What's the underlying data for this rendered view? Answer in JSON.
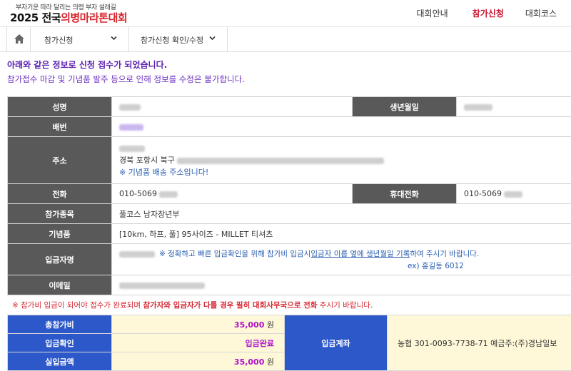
{
  "header": {
    "tagline": "부자기운 따라 달리는 의령 부자 설레길",
    "logo_prefix": "2025 전국",
    "logo_accent": "의병마라톤대회",
    "nav": [
      "대회안내",
      "참가신청",
      "대회코스"
    ],
    "active_nav": "참가신청",
    "accent_color": "#c8102e"
  },
  "subnav": {
    "home_icon": "home-icon",
    "menu1": "참가신청",
    "menu2": "참가신청 확인/수정"
  },
  "messages": {
    "line1": "아래와 같은 정보로 신청 접수가 되었습니다.",
    "line2": "참가접수 마감 및 기념품 발주 등으로 인해 정보를 수정은 불가합니다."
  },
  "info": {
    "name_label": "성명",
    "birth_label": "생년월일",
    "bib_label": "배번",
    "address_label": "주소",
    "address_city": "경북 포항시 북구",
    "address_note": "※ 기념품 배송 주소입니다!",
    "phone_label": "전화",
    "phone_value": "010-5069",
    "mobile_label": "휴대전화",
    "mobile_value": "010-5069",
    "event_label": "참가종목",
    "event_value": "풀코스 남자장년부",
    "souvenir_label": "기념품",
    "souvenir_value": "[10km, 하프, 풀] 95사이즈 - MILLET 티셔츠",
    "depositor_label": "입금자명",
    "depositor_note_a": "※ 정확하고 빠른 입금확인을 위해 참가비 입금시",
    "depositor_note_link": "입금자 이름 옆에 생년월일 기록",
    "depositor_note_b": "하여 주시기 바랍니다.",
    "depositor_example": "ex) 홍길동 6012",
    "email_label": "이메일"
  },
  "warning": {
    "part1": "※ 참가비 입금이 되어야 접수가 완료되며 ",
    "bold": "참가자와 입금자가 다를 경우 필히 대회사무국으로 전화",
    "part2": " 주시기 바랍니다."
  },
  "payment": {
    "total_label": "총참가비",
    "total_amount": "35,000",
    "currency": "원",
    "confirm_label": "입금확인",
    "confirm_status": "입금완료",
    "actual_label": "실입금액",
    "actual_amount": "35,000",
    "account_label": "입금계좌",
    "account_value": "농협 301-0093-7738-71 예금주:(주)경남일보"
  }
}
